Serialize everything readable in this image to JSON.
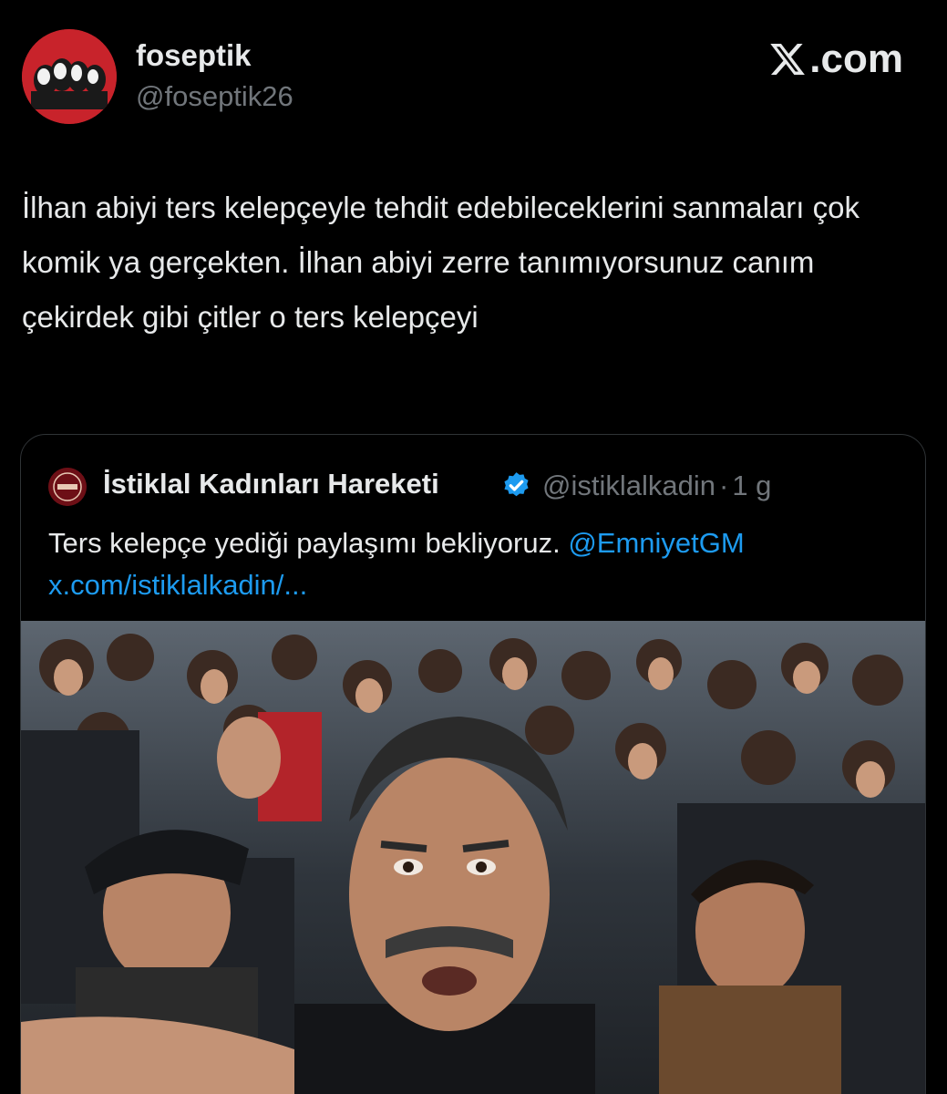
{
  "author": {
    "display_name": "foseptik",
    "handle": "@foseptik26",
    "avatar_icon": "avatar-red-portraits"
  },
  "site_logo": {
    "label": ".com",
    "icon": "x-logo-icon"
  },
  "tweet": {
    "text": "İlhan abiyi ters kelepçeyle tehdit edebileceklerini sanmaları çok komik ya gerçekten. İlhan abiyi zerre tanımıyorsunuz canım çekirdek gibi çitler o ters kelepçeyi"
  },
  "quoted": {
    "display_name": "İstiklal Kadınları Hareketi",
    "handle": "@istiklalkadin",
    "separator": "·",
    "time": "1 g",
    "text": "Ters kelepçe yediği paylaşımı bekliyoruz.",
    "mention": "@EmniyetGM",
    "link": "x.com/istiklalkadin/...",
    "verified_icon": "verified-badge-icon",
    "media_icon": "video-thumbnail-crowd"
  },
  "colors": {
    "background": "#000000",
    "text": "#e7e9ea",
    "secondary_text": "#71767b",
    "link": "#1d9bf0",
    "border": "#2f3336",
    "avatar_red": "#c8232b"
  }
}
